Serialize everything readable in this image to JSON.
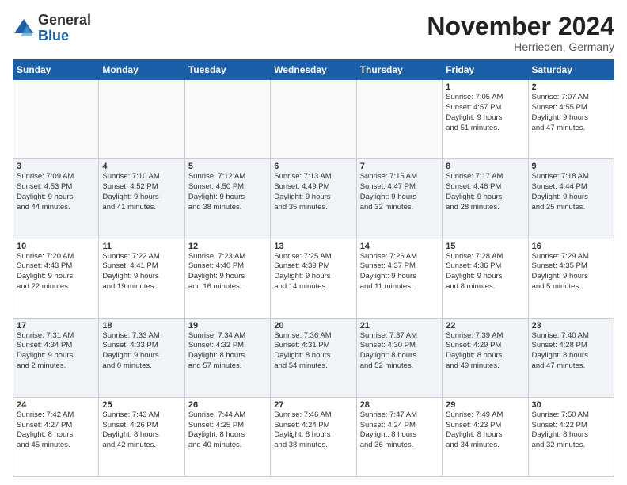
{
  "logo": {
    "general": "General",
    "blue": "Blue"
  },
  "header": {
    "month": "November 2024",
    "location": "Herrieden, Germany"
  },
  "weekdays": [
    "Sunday",
    "Monday",
    "Tuesday",
    "Wednesday",
    "Thursday",
    "Friday",
    "Saturday"
  ],
  "weeks": [
    [
      {
        "day": "",
        "info": ""
      },
      {
        "day": "",
        "info": ""
      },
      {
        "day": "",
        "info": ""
      },
      {
        "day": "",
        "info": ""
      },
      {
        "day": "",
        "info": ""
      },
      {
        "day": "1",
        "info": "Sunrise: 7:05 AM\nSunset: 4:57 PM\nDaylight: 9 hours\nand 51 minutes."
      },
      {
        "day": "2",
        "info": "Sunrise: 7:07 AM\nSunset: 4:55 PM\nDaylight: 9 hours\nand 47 minutes."
      }
    ],
    [
      {
        "day": "3",
        "info": "Sunrise: 7:09 AM\nSunset: 4:53 PM\nDaylight: 9 hours\nand 44 minutes."
      },
      {
        "day": "4",
        "info": "Sunrise: 7:10 AM\nSunset: 4:52 PM\nDaylight: 9 hours\nand 41 minutes."
      },
      {
        "day": "5",
        "info": "Sunrise: 7:12 AM\nSunset: 4:50 PM\nDaylight: 9 hours\nand 38 minutes."
      },
      {
        "day": "6",
        "info": "Sunrise: 7:13 AM\nSunset: 4:49 PM\nDaylight: 9 hours\nand 35 minutes."
      },
      {
        "day": "7",
        "info": "Sunrise: 7:15 AM\nSunset: 4:47 PM\nDaylight: 9 hours\nand 32 minutes."
      },
      {
        "day": "8",
        "info": "Sunrise: 7:17 AM\nSunset: 4:46 PM\nDaylight: 9 hours\nand 28 minutes."
      },
      {
        "day": "9",
        "info": "Sunrise: 7:18 AM\nSunset: 4:44 PM\nDaylight: 9 hours\nand 25 minutes."
      }
    ],
    [
      {
        "day": "10",
        "info": "Sunrise: 7:20 AM\nSunset: 4:43 PM\nDaylight: 9 hours\nand 22 minutes."
      },
      {
        "day": "11",
        "info": "Sunrise: 7:22 AM\nSunset: 4:41 PM\nDaylight: 9 hours\nand 19 minutes."
      },
      {
        "day": "12",
        "info": "Sunrise: 7:23 AM\nSunset: 4:40 PM\nDaylight: 9 hours\nand 16 minutes."
      },
      {
        "day": "13",
        "info": "Sunrise: 7:25 AM\nSunset: 4:39 PM\nDaylight: 9 hours\nand 14 minutes."
      },
      {
        "day": "14",
        "info": "Sunrise: 7:26 AM\nSunset: 4:37 PM\nDaylight: 9 hours\nand 11 minutes."
      },
      {
        "day": "15",
        "info": "Sunrise: 7:28 AM\nSunset: 4:36 PM\nDaylight: 9 hours\nand 8 minutes."
      },
      {
        "day": "16",
        "info": "Sunrise: 7:29 AM\nSunset: 4:35 PM\nDaylight: 9 hours\nand 5 minutes."
      }
    ],
    [
      {
        "day": "17",
        "info": "Sunrise: 7:31 AM\nSunset: 4:34 PM\nDaylight: 9 hours\nand 2 minutes."
      },
      {
        "day": "18",
        "info": "Sunrise: 7:33 AM\nSunset: 4:33 PM\nDaylight: 9 hours\nand 0 minutes."
      },
      {
        "day": "19",
        "info": "Sunrise: 7:34 AM\nSunset: 4:32 PM\nDaylight: 8 hours\nand 57 minutes."
      },
      {
        "day": "20",
        "info": "Sunrise: 7:36 AM\nSunset: 4:31 PM\nDaylight: 8 hours\nand 54 minutes."
      },
      {
        "day": "21",
        "info": "Sunrise: 7:37 AM\nSunset: 4:30 PM\nDaylight: 8 hours\nand 52 minutes."
      },
      {
        "day": "22",
        "info": "Sunrise: 7:39 AM\nSunset: 4:29 PM\nDaylight: 8 hours\nand 49 minutes."
      },
      {
        "day": "23",
        "info": "Sunrise: 7:40 AM\nSunset: 4:28 PM\nDaylight: 8 hours\nand 47 minutes."
      }
    ],
    [
      {
        "day": "24",
        "info": "Sunrise: 7:42 AM\nSunset: 4:27 PM\nDaylight: 8 hours\nand 45 minutes."
      },
      {
        "day": "25",
        "info": "Sunrise: 7:43 AM\nSunset: 4:26 PM\nDaylight: 8 hours\nand 42 minutes."
      },
      {
        "day": "26",
        "info": "Sunrise: 7:44 AM\nSunset: 4:25 PM\nDaylight: 8 hours\nand 40 minutes."
      },
      {
        "day": "27",
        "info": "Sunrise: 7:46 AM\nSunset: 4:24 PM\nDaylight: 8 hours\nand 38 minutes."
      },
      {
        "day": "28",
        "info": "Sunrise: 7:47 AM\nSunset: 4:24 PM\nDaylight: 8 hours\nand 36 minutes."
      },
      {
        "day": "29",
        "info": "Sunrise: 7:49 AM\nSunset: 4:23 PM\nDaylight: 8 hours\nand 34 minutes."
      },
      {
        "day": "30",
        "info": "Sunrise: 7:50 AM\nSunset: 4:22 PM\nDaylight: 8 hours\nand 32 minutes."
      }
    ]
  ]
}
